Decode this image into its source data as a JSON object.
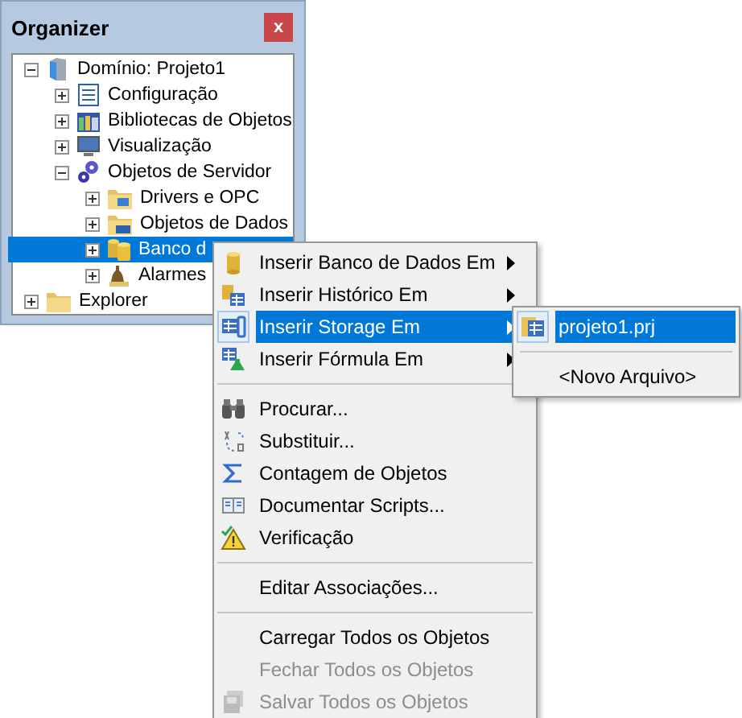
{
  "organizer": {
    "title": "Organizer",
    "close_label": "x",
    "tree": [
      {
        "label": "Domínio: Projeto1",
        "kind": "server",
        "expanded": true,
        "selected": false,
        "children": [
          {
            "label": "Configuração",
            "kind": "config",
            "expanded": false,
            "selected": false
          },
          {
            "label": "Bibliotecas de Objetos",
            "kind": "library",
            "expanded": false,
            "selected": false
          },
          {
            "label": "Visualização",
            "kind": "display",
            "expanded": false,
            "selected": false
          },
          {
            "label": "Objetos de Servidor",
            "kind": "gears",
            "expanded": true,
            "selected": false,
            "children": [
              {
                "label": "Drivers e OPC",
                "kind": "folder-driver",
                "expanded": false,
                "selected": false
              },
              {
                "label": "Objetos de Dados",
                "kind": "folder-data",
                "expanded": false,
                "selected": false
              },
              {
                "label": "Banco d",
                "kind": "database",
                "expanded": false,
                "selected": true
              },
              {
                "label": "Alarmes",
                "kind": "alarm",
                "expanded": false,
                "selected": false
              }
            ]
          }
        ]
      },
      {
        "label": "Explorer",
        "kind": "folder",
        "expanded": false,
        "selected": false
      }
    ]
  },
  "context_menu": [
    {
      "kind": "database",
      "label": "Inserir Banco de Dados Em",
      "submenu": true,
      "selected": false,
      "disabled": false
    },
    {
      "kind": "historic",
      "label": "Inserir Histórico Em",
      "submenu": true,
      "selected": false,
      "disabled": false
    },
    {
      "kind": "storage",
      "label": "Inserir Storage Em",
      "submenu": true,
      "selected": true,
      "disabled": false
    },
    {
      "kind": "formula",
      "label": "Inserir Fórmula Em",
      "submenu": true,
      "selected": false,
      "disabled": false
    },
    {
      "kind": "separator"
    },
    {
      "kind": "binoculars",
      "label": "Procurar...",
      "submenu": false,
      "selected": false,
      "disabled": false
    },
    {
      "kind": "replace",
      "label": "Substituir...",
      "submenu": false,
      "selected": false,
      "disabled": false
    },
    {
      "kind": "sigma",
      "label": "Contagem de Objetos",
      "submenu": false,
      "selected": false,
      "disabled": false
    },
    {
      "kind": "book",
      "label": "Documentar Scripts...",
      "submenu": false,
      "selected": false,
      "disabled": false
    },
    {
      "kind": "warning",
      "label": "Verificação",
      "submenu": false,
      "selected": false,
      "disabled": false
    },
    {
      "kind": "separator"
    },
    {
      "kind": "plain",
      "label": "Editar Associações...",
      "submenu": false,
      "selected": false,
      "disabled": false
    },
    {
      "kind": "separator"
    },
    {
      "kind": "plain",
      "label": "Carregar Todos os Objetos",
      "submenu": false,
      "selected": false,
      "disabled": false
    },
    {
      "kind": "plain",
      "label": "Fechar Todos os Objetos",
      "submenu": false,
      "selected": false,
      "disabled": true
    },
    {
      "kind": "save",
      "label": "Salvar Todos os Objetos",
      "submenu": false,
      "selected": false,
      "disabled": true
    }
  ],
  "submenu": [
    {
      "kind": "project",
      "label": "projeto1.prj",
      "selected": true
    },
    {
      "kind": "separator"
    },
    {
      "kind": "plain",
      "label": "<Novo Arquivo>",
      "selected": false
    }
  ]
}
